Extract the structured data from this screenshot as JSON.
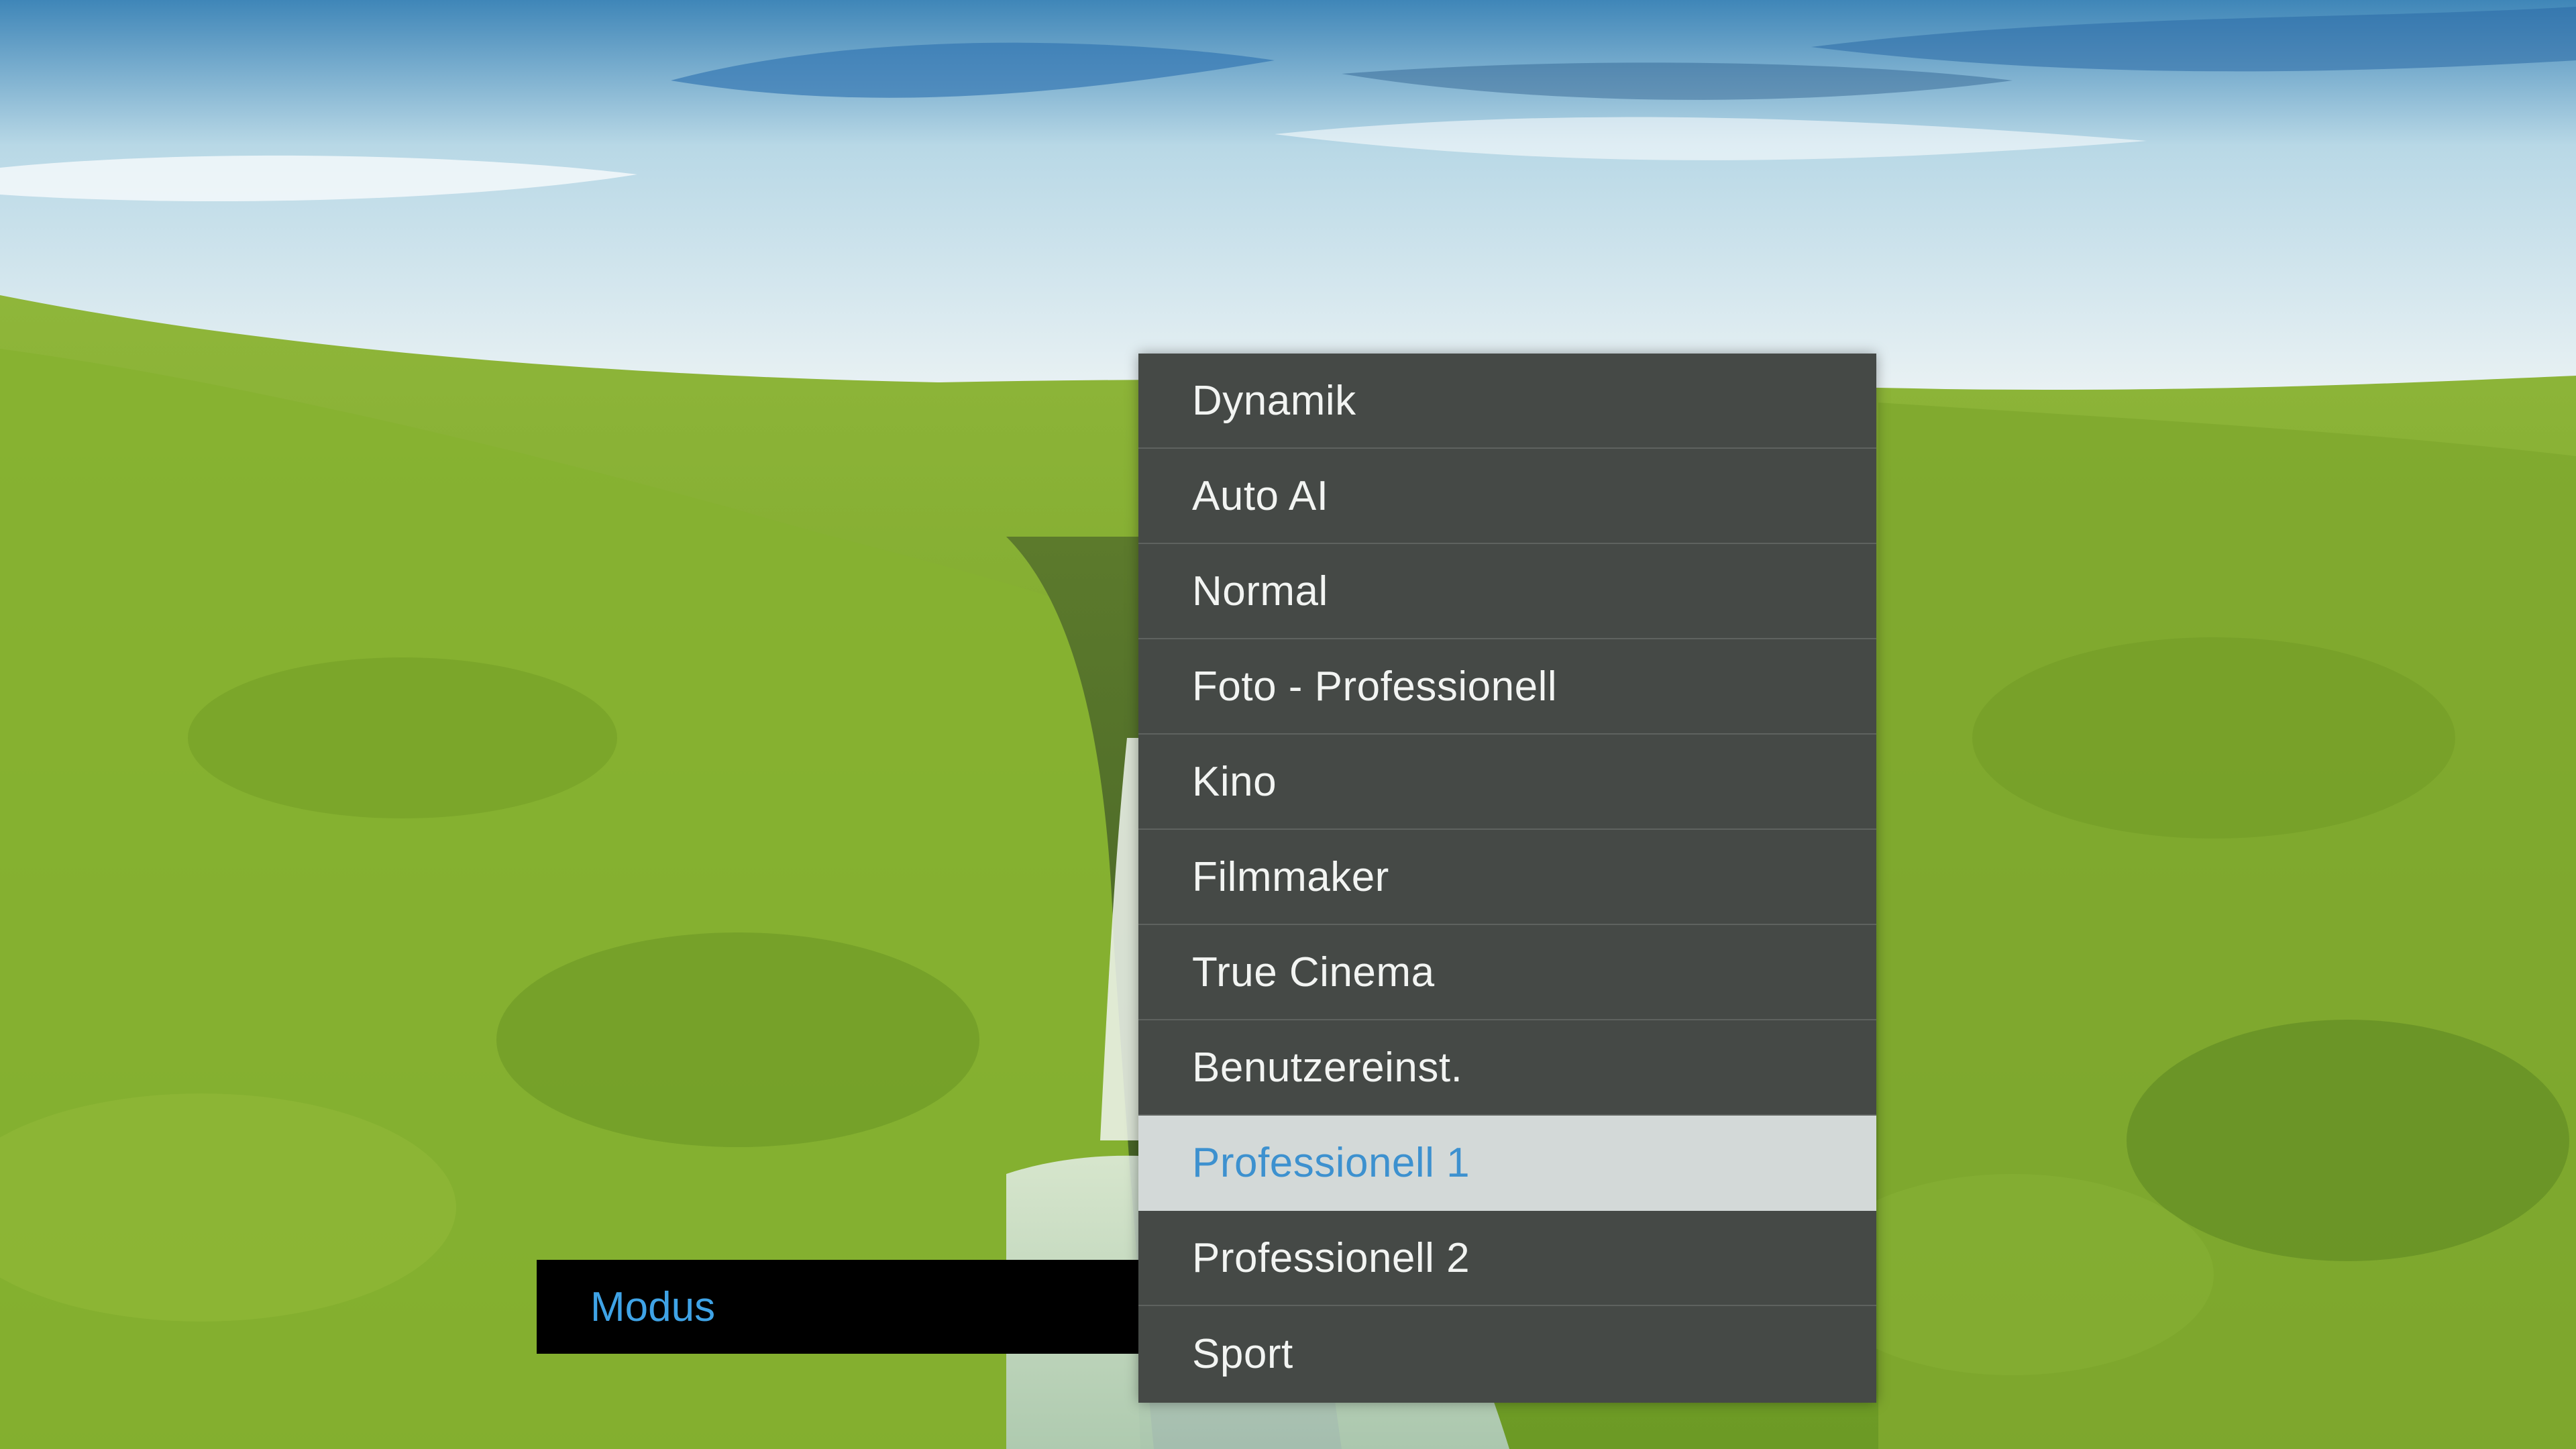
{
  "settings": {
    "label": "Modus"
  },
  "menu": {
    "items": [
      {
        "label": "Dynamik"
      },
      {
        "label": "Auto AI"
      },
      {
        "label": "Normal"
      },
      {
        "label": "Foto - Professionell"
      },
      {
        "label": "Kino"
      },
      {
        "label": "Filmmaker"
      },
      {
        "label": "True Cinema"
      },
      {
        "label": "Benutzereinst."
      },
      {
        "label": "Professionell 1"
      },
      {
        "label": "Professionell 2"
      },
      {
        "label": "Sport"
      }
    ],
    "selected_label": "Professionell 1"
  },
  "colors": {
    "panel": "#454946",
    "selected_background": "#d3d9d8",
    "selected_text": "#3d91cf",
    "label_text": "#3fa3e6"
  }
}
